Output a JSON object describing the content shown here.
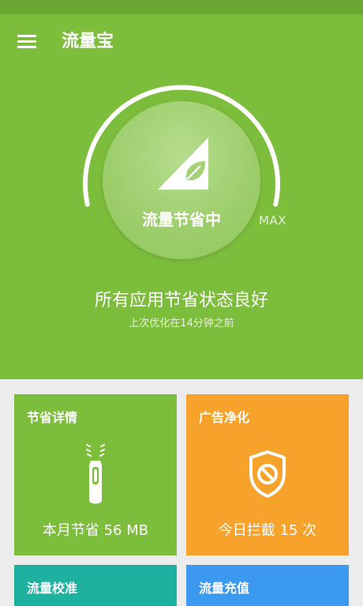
{
  "header": {
    "app_title": "流量宝",
    "menu_icon": "menu-icon"
  },
  "gauge": {
    "status_label": "流量节省中",
    "max_label": "MAX",
    "icon": "signal-leaf-icon"
  },
  "status": {
    "main_text": "所有应用节省状态良好",
    "sub_text": "上次优化在14分钟之前"
  },
  "cards": {
    "savings": {
      "title": "节省详情",
      "value": "本月节省 56 MB",
      "icon": "zipper-icon",
      "color": "#7cbd3c"
    },
    "ads": {
      "title": "广告净化",
      "value": "今日拦截 15 次",
      "icon": "shield-block-icon",
      "color": "#f7a22b"
    },
    "calibrate": {
      "title": "流量校准",
      "color": "#1fb1a0"
    },
    "recharge": {
      "title": "流量充值",
      "color": "#3c99f0"
    }
  },
  "colors": {
    "primary_green": "#7cbd3c",
    "status_bar": "#6aa833",
    "orange": "#f7a22b",
    "teal": "#1fb1a0",
    "blue": "#3c99f0"
  }
}
